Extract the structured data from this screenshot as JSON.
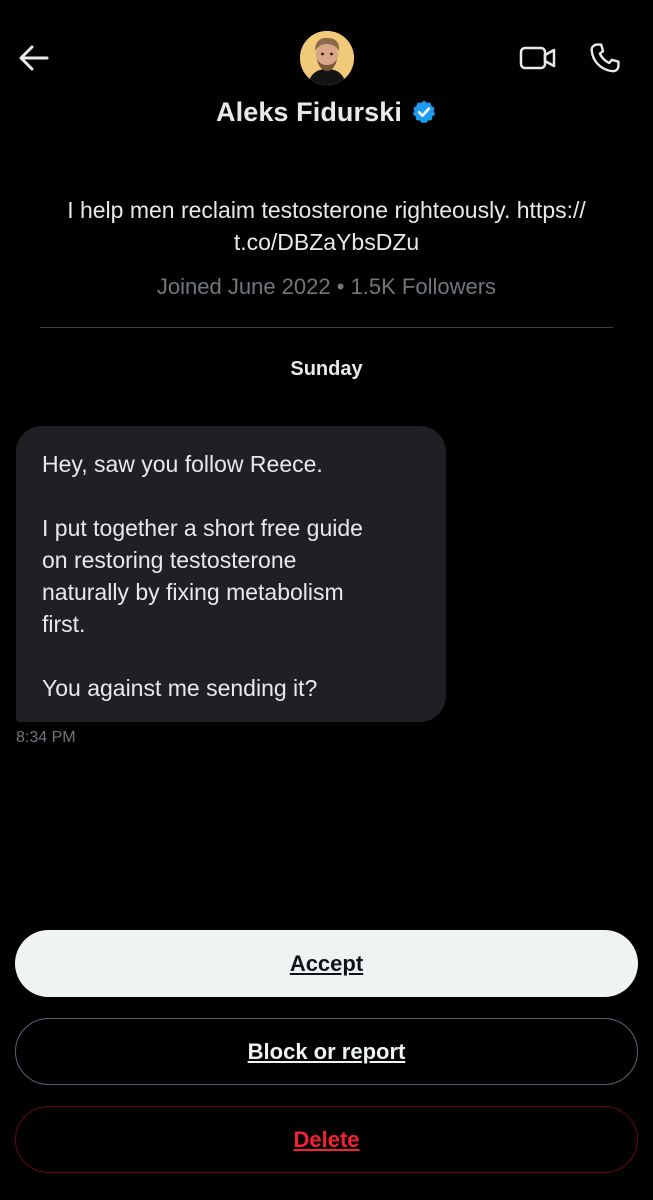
{
  "header": {
    "name": "Aleks Fidurski",
    "back_icon": "arrow-left-icon",
    "video_icon": "video-camera-icon",
    "phone_icon": "phone-icon",
    "verified_icon": "verified-badge-icon",
    "verified_color": "#1d9bf0"
  },
  "profile": {
    "bio_text": "I help men reclaim testosterone righteously. https://",
    "bio_link": "t.co/DBZaYbsDZu",
    "meta": "Joined June 2022 • 1.5K Followers"
  },
  "conversation": {
    "day_label": "Sunday",
    "message": {
      "line1": "Hey, saw you follow Reece.",
      "line2": "I put together a short free guide",
      "line3": "on restoring testosterone",
      "line4": "naturally by fixing metabolism",
      "line5": "first.",
      "line6": "You against me sending it?"
    },
    "timestamp": "8:34 PM"
  },
  "actions": {
    "accept": "Accept",
    "block": "Block or report",
    "delete": "Delete"
  },
  "colors": {
    "background": "#000000",
    "bubble": "#1f2023",
    "muted_text": "#71767b",
    "accept_bg": "#eff3f4",
    "delete_text": "#f4212e",
    "avatar_bg": "#f0c979"
  }
}
